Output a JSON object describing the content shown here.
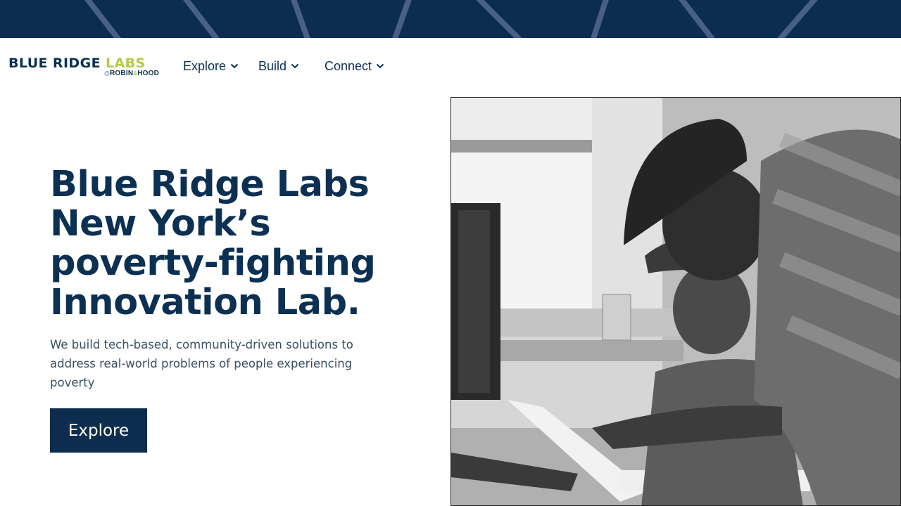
{
  "logo": {
    "part1": "BLUE RIDGE ",
    "part2": "LABS",
    "at": "@",
    "sub1": "ROBIN",
    "amp": "&",
    "sub2": "HOOD"
  },
  "nav": {
    "items": [
      {
        "label": "Explore",
        "icon": "chevron-down-icon"
      },
      {
        "label": "Build",
        "icon": "chevron-down-icon"
      },
      {
        "label": "Connect",
        "icon": "chevron-down-icon"
      }
    ]
  },
  "hero": {
    "headline_lines": [
      "Blue Ridge Labs",
      "New York’s",
      "poverty-fighting",
      "Innovation Lab."
    ],
    "subtext": "We build tech-based, community-driven solutions to address real-world problems of people experiencing poverty",
    "cta_label": "Explore",
    "image": {
      "subject": "two people looking at documents at a desk with a computer monitor",
      "style": "black-and-white photograph"
    }
  },
  "colors": {
    "navy": "#0c2d4e",
    "accent_green": "#b5c94a",
    "banner_lines": "#4a5f86"
  }
}
